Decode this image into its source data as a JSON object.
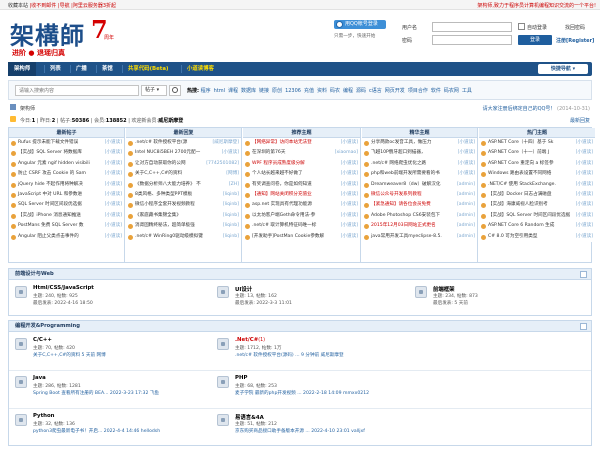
{
  "topbar": {
    "left_prefix": "收藏本站",
    "left_links": [
      "|收不到邮件",
      "|导航",
      "|阿里云服务器3折起"
    ],
    "right": "架构师,致力于程序员计算机编程知识交流的一个平台!"
  },
  "logo": {
    "main": "架構師",
    "num": "7",
    "year": "周年",
    "sub": "进阶 ● 退瑶归真"
  },
  "qq": {
    "button": "用QQ帐号登录",
    "hint": "只需一步，快速开始"
  },
  "login": {
    "user_label": "用户名",
    "pass_label": "密码",
    "auto_login": "自动登录",
    "find_password": "找回密码",
    "login_button": "登录",
    "register": "注册[Register]"
  },
  "nav": {
    "items": [
      {
        "label": "架构师",
        "style": "active"
      },
      {
        "label": "列表",
        "style": "normal"
      },
      {
        "label": "广播",
        "style": "normal"
      },
      {
        "label": "茶馆",
        "style": "normal"
      },
      {
        "label": "共享代码(Beta)",
        "style": "yellow"
      },
      {
        "label": "小道读博客",
        "style": "yellow"
      }
    ],
    "quick": "快捷导航 ▾"
  },
  "search": {
    "placeholder": "请输入搜索内容",
    "select": "帖子 ▾",
    "hot_label": "热搜:",
    "hot": [
      "程序",
      "html",
      "课程",
      "数据库",
      "链接",
      "原创",
      "12306",
      "充值",
      "资料",
      "码农",
      "编程",
      "源码",
      "c语言",
      "网页开发",
      "项目合作",
      "软件",
      "码农网",
      "工具"
    ]
  },
  "breadcrumb": {
    "text": "架构师",
    "ask": "请大家注册后绑定自己的QQ号！",
    "ask_date": "(2014-10-31)"
  },
  "stats": {
    "today_label": "今日:",
    "today": "1",
    "yesterday_label": "昨日:",
    "yesterday": "2",
    "posts_label": "帖子:",
    "posts": "50386",
    "members_label": "会员:",
    "members": "138852",
    "newest_label": "欢迎新会员:",
    "newest": "威尼斯摩登",
    "new_posts": "最新回复"
  },
  "top_grid": {
    "columns": [
      {
        "title": "最新帖子",
        "items": [
          {
            "text": "Rufus 提示未能下载文件错误",
            "tag": "[小道读]"
          },
          {
            "text": "【实战】SQL Server 将数据库",
            "tag": "[小道读]"
          },
          {
            "text": "Angular 元素 ngif hidden visibili",
            "tag": "[小道读]"
          },
          {
            "text": "防止 CSRF 攻击 Cookie 的 Sam",
            "tag": "[小道读]"
          },
          {
            "text": "jQuery hide 不起作用将种解决",
            "tag": "[小道读]"
          },
          {
            "text": "JavaScript 中对 URL 和参数进",
            "tag": "[小道读]"
          },
          {
            "text": "SQL Server 时间区间段优选据",
            "tag": "[小道读]"
          },
          {
            "text": "【实战】iPhone 消息通知推送",
            "tag": "[小道读]"
          },
          {
            "text": "PostMans 免费 SQL Server 数",
            "tag": "[小道读]"
          },
          {
            "text": "Angular 阻止父类点击事件的",
            "tag": "[小道读]"
          }
        ]
      },
      {
        "title": "最新回复",
        "items": [
          {
            "text": ".net/c# 软件授权平台(源",
            "tag": "[威尼斯摩登]"
          },
          {
            "text": "Intel NUC8i5BEH 2700元配一",
            "tag": "[小道读]"
          },
          {
            "text": "让对方自动获取你的公网",
            "tag": "[7742501082]"
          },
          {
            "text": "关于C,C++,C#的资料",
            "tag": "[网博]"
          },
          {
            "text": "《数据分析师八大能力培养》 不",
            "tag": "[ZH]"
          },
          {
            "text": "8类风格、多种类型PPT模板",
            "tag": "[liqinb]"
          },
          {
            "text": "微信小程序全套开发视频教程",
            "tag": "[liqinb]"
          },
          {
            "text": "《家庭藏书集锦全集》",
            "tag": "[liqinb]"
          },
          {
            "text": "消肾固精终秘法，超简单极强",
            "tag": "[liqinb]"
          },
          {
            "text": ".net/c# WinRing0驱动级模拟键",
            "tag": "[liqinb]"
          }
        ]
      },
      {
        "title": "推荐主题",
        "items": [
          {
            "text": "【网络异常】访问本站无法登",
            "tag": "[小道读]",
            "red": true
          },
          {
            "text": "在深圳的第76天",
            "tag": "[xiaomao]"
          },
          {
            "text": "WPF 程序员成熟度级分解",
            "tag": "[小道读]",
            "red": true
          },
          {
            "text": "个人站长越来越不好做了",
            "tag": "[小道读]"
          },
          {
            "text": "有奖调查问卷，你是如何知道",
            "tag": "[小道读]"
          },
          {
            "text": "【通知】网站关闭积分充值业",
            "tag": "[小道读]",
            "red": true
          },
          {
            "text": "asp.net 实现具有代理功能源",
            "tag": "[小道读]"
          },
          {
            "text": "以太坊客户端Geth命令用法-参",
            "tag": "[小道读]"
          },
          {
            "text": ".net/c# 取计算机特征码唯一标",
            "tag": "[小道读]"
          },
          {
            "text": "[开发助手]PostMan Cookie参数解",
            "tag": "[小道读]"
          }
        ]
      },
      {
        "title": "精华主题",
        "items": [
          {
            "text": "分享两款oc发音工具，做压力",
            "tag": "[小道读]"
          },
          {
            "text": "飞越10P俄牙超口到描器，",
            "tag": "[小道读]"
          },
          {
            "text": ".net/c# 网络爬虫优化之路",
            "tag": "[小道读]"
          },
          {
            "text": "php和web前端开发所需要看的书",
            "tag": "[小道读]"
          },
          {
            "text": "Dreamweaver8（dw）破解汉化",
            "tag": "[admin]"
          },
          {
            "text": "微信公众号开发系列教程",
            "tag": "[admin]",
            "red": true
          },
          {
            "text": "【紧急通知】请各位会员免费",
            "tag": "[admin]",
            "red": true
          },
          {
            "text": "Adobe Photoshop CS6安装包下",
            "tag": "[admin]"
          },
          {
            "text": "2015年12月03日网站正式更名",
            "tag": "[admin]",
            "red": true
          },
          {
            "text": "java常用开发工具myeclipse-8.5.",
            "tag": "[admin]"
          }
        ]
      },
      {
        "title": "热门主题",
        "items": [
          {
            "text": "ASP.NET Core（十四）基于 Sk",
            "tag": "[小道读]"
          },
          {
            "text": "ASP.NET Core（十一）前端 J",
            "tag": "[小道读]"
          },
          {
            "text": "ASP.NET Core 重定向 a 标签参",
            "tag": "[小道读]"
          },
          {
            "text": "Windows 路由表设置不同网络",
            "tag": "[小道读]"
          },
          {
            "text": ".NET/C# 使用 StackExchange.",
            "tag": "[小道读]"
          },
          {
            "text": "【实战】Docker 日志占满磁盘",
            "tag": "[小道读]"
          },
          {
            "text": "【实战】海康威视人脸识别考",
            "tag": "[小道读]"
          },
          {
            "text": "【实战】SQL Server 时间区间段优选据",
            "tag": "[小道读]"
          },
          {
            "text": "ASP.NET Core 6 Random 生成",
            "tag": "[小道读]"
          },
          {
            "text": "C# 8.0 可为空引用类型",
            "tag": "[小道读]"
          }
        ]
      }
    ]
  },
  "sections": [
    {
      "title": "前端设计与Web",
      "forums": [
        {
          "name": "Html/CSS/JavaScript",
          "count": "",
          "meta": "主题: 240, 帖数: 925",
          "last": "最后发表: 2022-4-16 18:50",
          "last_link": ""
        },
        {
          "name": "UI设计",
          "count": "",
          "meta": "主题: 13, 帖数: 162",
          "last": "最后发表: 2022-3-3 11:01",
          "last_link": ""
        },
        {
          "name": "前端框架",
          "count": "",
          "meta": "主题: 234, 帖数: 873",
          "last": "最后发表: 5 天前",
          "last_link": ""
        }
      ]
    },
    {
      "title": "编程开发&Programming",
      "forums": [
        {
          "name": "C/C++",
          "count": "",
          "meta": "主题: 70, 帖数: 420",
          "last": "",
          "last_link": "关于C,C++,C#的资料 5 天前 网博",
          "red": false
        },
        {
          "name": ".Net/C#",
          "count": "(1)",
          "meta": "主题: 1712, 帖数: 1万",
          "last": "",
          "last_link": ".net/c# 软件授权平台(源码) ... 9 分钟前 威尼斯摩登",
          "red": true
        },
        {
          "name": "",
          "count": "",
          "meta": "",
          "last": "",
          "last_link": ""
        },
        {
          "name": "Java",
          "count": "",
          "meta": "主题: 286, 帖数: 1281",
          "last": "",
          "last_link": "Spring Boot 查看所有注册的 BEA... 2022-3-23 17:32 飞鱼"
        },
        {
          "name": "PHP",
          "count": "",
          "meta": "主题: 68, 帖数: 253",
          "last": "",
          "last_link": "麦子学院 最新的php开发视频 ... 2022-2-18 14:09 mmxx0212"
        },
        {
          "name": "",
          "count": "",
          "meta": "",
          "last": "",
          "last_link": ""
        },
        {
          "name": "Python",
          "count": "",
          "meta": "主题: 32, 帖数: 136",
          "last": "",
          "last_link": "python3爬虫最新电子书！开启... 2022-4-4 14:46 hellodsh"
        },
        {
          "name": "易语言&4A",
          "count": "",
          "meta": "主题: 51, 帖数: 212",
          "last": "",
          "last_link": "京东购买商品接口助手备版本开源 ... 2022-4-10 23:01 valljxf"
        },
        {
          "name": "",
          "count": "",
          "meta": "",
          "last": "",
          "last_link": ""
        }
      ]
    }
  ]
}
